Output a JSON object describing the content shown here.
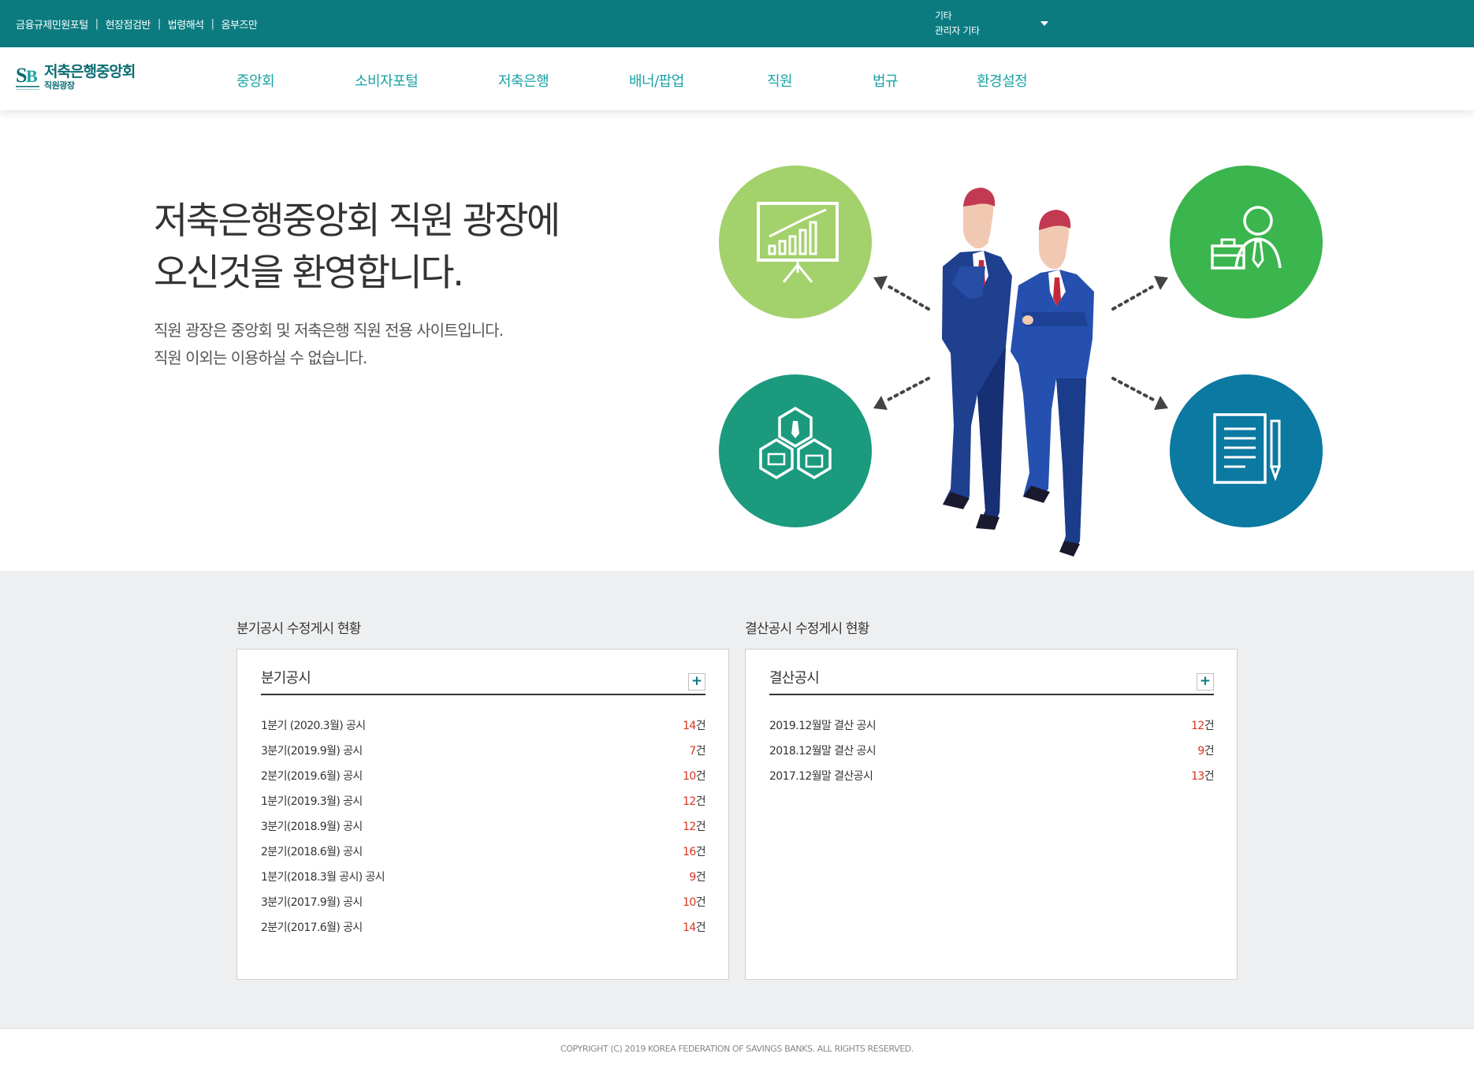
{
  "util_links": [
    "금융규제민원포털",
    "현장점검반",
    "법령해석",
    "옴부즈만"
  ],
  "user": {
    "line1": "기타",
    "line2": "관리자 기타"
  },
  "logo": {
    "mark": "SB",
    "title": "저축은행중앙회",
    "subtitle": "직원광장"
  },
  "gnb": [
    "중앙회",
    "소비자포털",
    "저축은행",
    "배너/팝업",
    "직원",
    "법규",
    "환경설정"
  ],
  "hero": {
    "title_line1": "저축은행중앙회 직원 광장에",
    "title_line2": "오신것을 환영합니다.",
    "desc_line1": "직원 광장은 중앙회 및 저축은행 직원 전용 사이트입니다.",
    "desc_line2": "직원 이외는 이용하실 수 없습니다."
  },
  "illustration": {
    "icons": [
      "presentation-chart-icon",
      "businessman-briefcase-icon",
      "hexagon-network-icon",
      "document-pen-icon"
    ],
    "colors": {
      "lime": "#a3d16b",
      "green": "#3bb54d",
      "teal": "#1b9a7e",
      "blue": "#0b79a1"
    }
  },
  "quarterly": {
    "section_title": "분기공시 수정게시 현황",
    "panel_title": "분기공시",
    "more_label": "+",
    "rows": [
      {
        "label": "1분기 (2020.3월) 공시",
        "count": "14",
        "unit": "건"
      },
      {
        "label": "3분기(2019.9월) 공시",
        "count": "7",
        "unit": "건"
      },
      {
        "label": "2분기(2019.6월) 공시",
        "count": "10",
        "unit": "건"
      },
      {
        "label": "1분기(2019.3월) 공시",
        "count": "12",
        "unit": "건"
      },
      {
        "label": "3분기(2018.9월) 공시",
        "count": "12",
        "unit": "건"
      },
      {
        "label": "2분기(2018.6월) 공시",
        "count": "16",
        "unit": "건"
      },
      {
        "label": "1분기(2018.3월 공시) 공시",
        "count": "9",
        "unit": "건"
      },
      {
        "label": "3분기(2017.9월) 공시",
        "count": "10",
        "unit": "건"
      },
      {
        "label": "2분기(2017.6월) 공시",
        "count": "14",
        "unit": "건"
      }
    ]
  },
  "settlement": {
    "section_title": "결산공시 수정게시 현황",
    "panel_title": "결산공시",
    "more_label": "+",
    "rows": [
      {
        "label": "2019.12월말 결산 공시",
        "count": "12",
        "unit": "건"
      },
      {
        "label": "2018.12월말 결산 공시",
        "count": "9",
        "unit": "건"
      },
      {
        "label": "2017.12월말 결산공시",
        "count": "13",
        "unit": "건"
      }
    ]
  },
  "footer": {
    "copyright": "COPYRIGHT (C) 2019 KOREA FEDERATION OF SAVINGS BANKS. ALL RIGHTS RESERVED."
  },
  "theme": {
    "primary": "#0b7b80",
    "nav_text": "#1aa2a4",
    "count_red": "#d9331f",
    "section_bg": "#eeeff0"
  }
}
